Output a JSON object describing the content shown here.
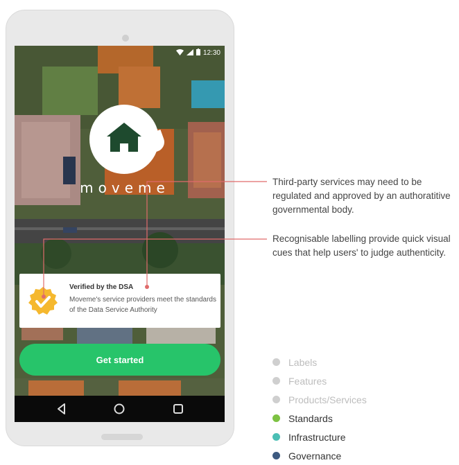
{
  "phone": {
    "status_time": "12:30",
    "brand_name": "moveme",
    "verified_card": {
      "title": "Verified by the DSA",
      "body": "Moveme's service providers meet the standards of the Data Service Authority"
    },
    "cta_label": "Get started",
    "nav_icons": [
      "back-icon",
      "home-icon",
      "recents-icon"
    ]
  },
  "callouts": [
    "Third-party services may need to be regulated and approved by an authoratitive governmental body.",
    "Recognisable labelling provide quick visual cues that help users' to judge authenticity."
  ],
  "legend": [
    {
      "label": "Labels",
      "color": "#cfcfcf",
      "text_color": "#bdbdbd"
    },
    {
      "label": "Features",
      "color": "#cfcfcf",
      "text_color": "#bdbdbd"
    },
    {
      "label": "Products/Services",
      "color": "#cfcfcf",
      "text_color": "#bdbdbd"
    },
    {
      "label": "Standards",
      "color": "#7dc242",
      "text_color": "#333333"
    },
    {
      "label": "Infrastructure",
      "color": "#4bbfb5",
      "text_color": "#333333"
    },
    {
      "label": "Governance",
      "color": "#3d5a80",
      "text_color": "#333333"
    }
  ],
  "colors": {
    "accent_green": "#27c46a",
    "badge_yellow": "#f5b82e",
    "callout_line": "#e06b6b"
  }
}
